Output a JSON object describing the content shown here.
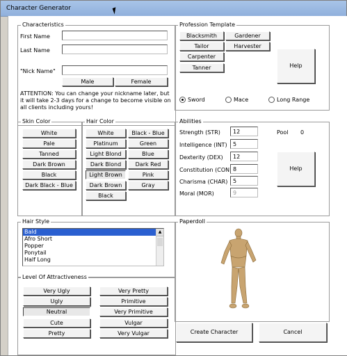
{
  "window": {
    "title": "Character Generator"
  },
  "characteristics": {
    "legend": "Characteristics",
    "first_name_label": "First Name",
    "last_name_label": "Last Name",
    "nick_name_label": "\"Nick Name\"",
    "first_name_value": "",
    "last_name_value": "",
    "nick_name_value": "",
    "male_label": "Male",
    "female_label": "Female",
    "attention": "ATTENTION: You can change your nickname later, but it will take 2-3 days for a change to become visible on all clients including yours!"
  },
  "profession": {
    "legend": "Profession Template",
    "buttons": [
      "Blacksmith",
      "Gardener",
      "Tailor",
      "Harvester",
      "Carpenter",
      "Tanner"
    ],
    "help_label": "Help",
    "weapons": [
      "Sword",
      "Mace",
      "Long Range"
    ],
    "selected_weapon": "Sword"
  },
  "skin_color": {
    "legend": "Skin Color",
    "options": [
      "White",
      "Pale",
      "Tanned",
      "Dark Brown",
      "Black",
      "Dark Black - Blue"
    ]
  },
  "hair_color": {
    "legend": "Hair Color",
    "options": [
      "White",
      "Black - Blue",
      "Platinum",
      "Green",
      "Light Blond",
      "Blue",
      "Dark Blond",
      "Dark Red",
      "Light Brown",
      "Pink",
      "Dark Brown",
      "Gray",
      "Black"
    ],
    "selected": "Light Brown"
  },
  "abilities": {
    "legend": "Abilities",
    "pool_label": "Pool",
    "pool_value": "0",
    "help_label": "Help",
    "stats": [
      {
        "label": "Strength (STR)",
        "value": "12"
      },
      {
        "label": "Intelligence (INT)",
        "value": "5"
      },
      {
        "label": "Dexterity (DEX)",
        "value": "12"
      },
      {
        "label": "Constitution (CON)",
        "value": "8"
      },
      {
        "label": "Charisma (CHAR)",
        "value": "5"
      },
      {
        "label": "Moral (MOR)",
        "value": "9"
      }
    ]
  },
  "hair_style": {
    "legend": "Hair Style",
    "items": [
      "Bald",
      "Afro Short",
      "Popper",
      "Ponytail",
      "Half Long"
    ],
    "selected": "Bald"
  },
  "paperdoll": {
    "legend": "Paperdoll"
  },
  "attractiveness": {
    "legend": "Level Of Attractiveness",
    "options": [
      "Very Ugly",
      "Very Pretty",
      "Ugly",
      "Primitive",
      "Neutral",
      "Very Primitive",
      "Cute",
      "Vulgar",
      "Pretty",
      "Very Vulgar"
    ],
    "selected": "Neutral"
  },
  "actions": {
    "create_label": "Create Character",
    "cancel_label": "Cancel"
  }
}
